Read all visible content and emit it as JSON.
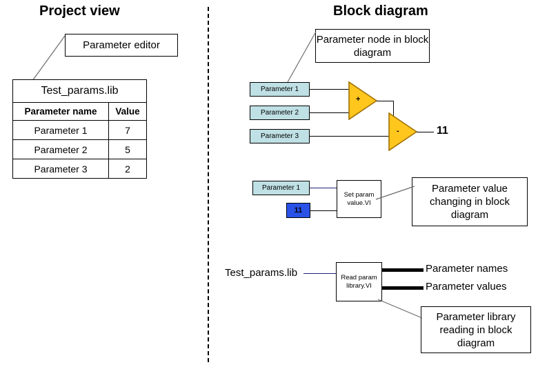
{
  "titles": {
    "left": "Project view",
    "right": "Block diagram"
  },
  "project_view": {
    "callout": "Parameter editor",
    "library_name": "Test_params.lib",
    "table": {
      "headers": [
        "Parameter name",
        "Value"
      ],
      "rows": [
        {
          "name": "Parameter 1",
          "value": "7"
        },
        {
          "name": "Parameter 2",
          "value": "5"
        },
        {
          "name": "Parameter 3",
          "value": "2"
        }
      ]
    }
  },
  "block_diagram": {
    "callout_node": "Parameter node in block diagram",
    "callout_value": "Parameter value changing in block diagram",
    "callout_library": "Parameter library reading in block diagram",
    "math": {
      "nodes": [
        "Parameter 1",
        "Parameter 2",
        "Parameter 3"
      ],
      "op_add": "+",
      "op_sub": "-",
      "result": "11"
    },
    "set_value": {
      "param_node": "Parameter 1",
      "constant": "11",
      "vi_name": "Set param value.VI"
    },
    "read_library": {
      "input_label": "Test_params.lib",
      "vi_name": "Read param library.VI",
      "output_names": "Parameter names",
      "output_values": "Parameter values"
    }
  },
  "colors": {
    "param_node_fill": "#bfe0e4",
    "constant_fill": "#2a52e6",
    "operator_fill": "#ffc61e",
    "operator_stroke": "#a07000",
    "wire": "#000000",
    "wire_blue": "#20207a",
    "leader": "#6b6b6b"
  }
}
